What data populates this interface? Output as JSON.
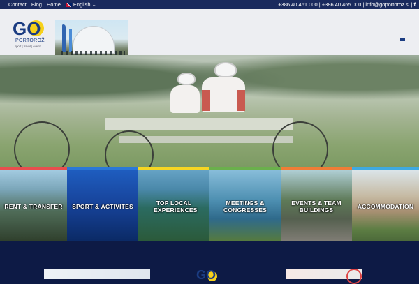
{
  "topbar": {
    "links": [
      "Contact",
      "Blog",
      "Home"
    ],
    "language": "English",
    "contact_text": "+386 40 461 000 | +386 40 465 000 | info@goportoroz.si |",
    "social_icon": "facebook-icon"
  },
  "logo": {
    "go": "GO",
    "city": "PORTOROŽ",
    "tagline": "sport | travel | event"
  },
  "header": {
    "menu_icon": "hamburger-icon"
  },
  "hero": {
    "slides_count": 7,
    "active_slide": 1
  },
  "tiles": [
    {
      "label": "RENT & TRANSFER",
      "bar_color": "#e94e4e"
    },
    {
      "label": "SPORT & ACTIVITES",
      "bar_color": "#2b78d8"
    },
    {
      "label": "TOP LOCAL EXPERIENCES",
      "bar_color": "#f5d623"
    },
    {
      "label": "MEETINGS & CONGRESSES",
      "bar_color": "#6ab04c"
    },
    {
      "label": "EVENTS & TEAM BUILDINGS",
      "bar_color": "#ef7d36"
    },
    {
      "label": "ACCOMMODATION",
      "bar_color": "#3fa9e0"
    }
  ],
  "colors": {
    "brand_navy": "#1b3c82",
    "brand_yellow": "#f7d11a",
    "topbar_bg": "#1a2a5e",
    "footer_bg": "#0d1a45"
  }
}
